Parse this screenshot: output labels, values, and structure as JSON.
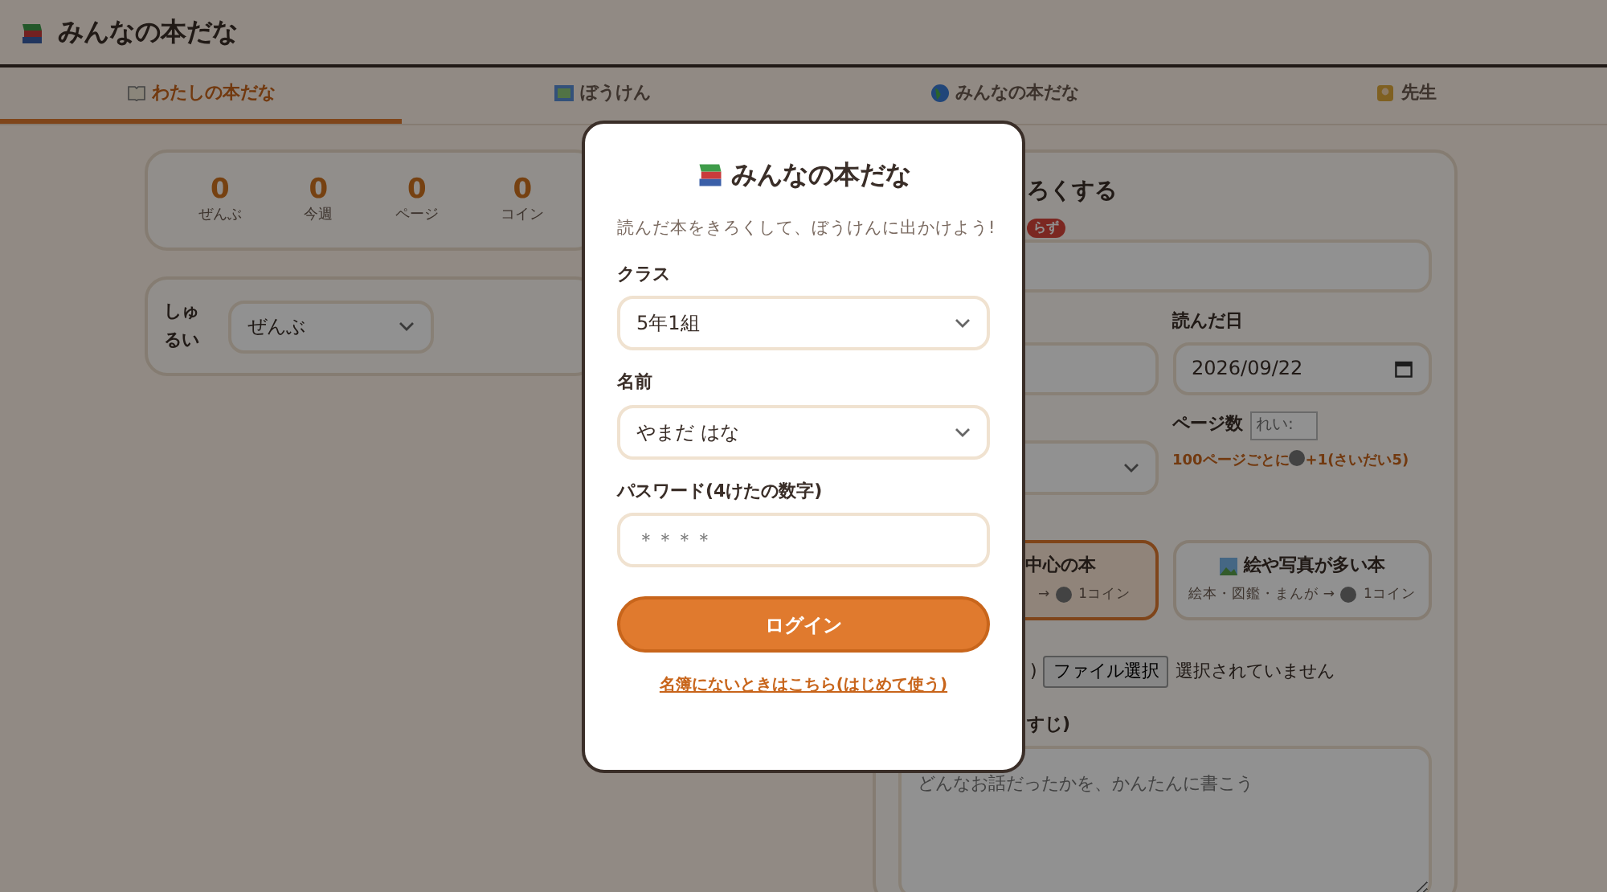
{
  "header": {
    "title": "みんなの本だな"
  },
  "tabs": [
    {
      "label": "わたしの本だな",
      "selected": true
    },
    {
      "label": "ぼうけん",
      "selected": false
    },
    {
      "label": "みんなの本だな",
      "selected": false
    },
    {
      "label": "先生",
      "selected": false
    }
  ],
  "stats": [
    {
      "value": "0",
      "label": "ぜんぶ"
    },
    {
      "value": "0",
      "label": "今週"
    },
    {
      "value": "0",
      "label": "ページ"
    },
    {
      "value": "0",
      "label": "コイン"
    }
  ],
  "filter": {
    "label": "しゅるい",
    "value": "ぜんぶ"
  },
  "record_form": {
    "title": "ろくする",
    "badge": "らず",
    "date_label": "読んだ日",
    "date_value": "2026/09/22",
    "pages_label": "ページ数",
    "pages_placeholder": "れい:",
    "coin_hint_before": "100ページごとに",
    "coin_hint_after": "+1(さいだい5)",
    "choices": [
      {
        "title": "中心の本",
        "note": "→",
        "coins": "1コイン",
        "selected": true
      },
      {
        "title": "絵や写真が多い本",
        "note": "絵本・図鑑・まんが →",
        "coins": "1コイン",
        "selected": false
      }
    ],
    "file_paren": ")",
    "file_button": "ファイル選択",
    "file_status": "選択されていません",
    "summary_label": "すじ)",
    "summary_placeholder": "どんなお話だったかを、かんたんに書こう"
  },
  "login_modal": {
    "title": "みんなの本だな",
    "subtitle": "読んだ本をきろくして、ぼうけんに出かけよう!",
    "fields": [
      {
        "label": "クラス",
        "kind": "select",
        "value": "5年1組"
      },
      {
        "label": "名前",
        "kind": "select",
        "value": "やまだ はな"
      },
      {
        "label": "パスワード(4けたの数字)",
        "kind": "password",
        "placeholder": "＊＊＊＊"
      }
    ],
    "button": "ログイン",
    "link": "名簿にないときはこちら(はじめて使う)"
  }
}
